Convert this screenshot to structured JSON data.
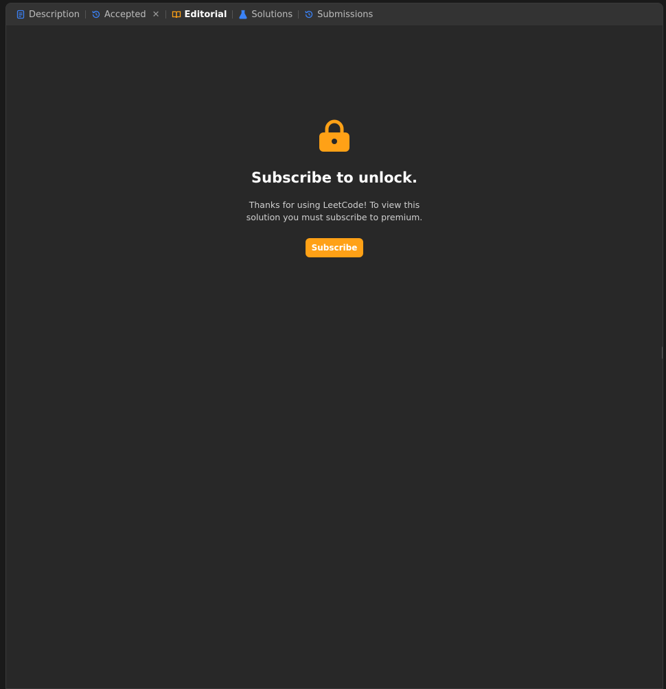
{
  "tabs": [
    {
      "label": "Description",
      "icon": "document-icon",
      "color": "#3b82f6"
    },
    {
      "label": "Accepted",
      "icon": "history-icon",
      "color": "#3b82f6",
      "closable": true
    },
    {
      "label": "Editorial",
      "icon": "book-icon",
      "color": "#ffa116",
      "active": true
    },
    {
      "label": "Solutions",
      "icon": "flask-icon",
      "color": "#3b82f6"
    },
    {
      "label": "Submissions",
      "icon": "history-icon",
      "color": "#3b82f6"
    }
  ],
  "lock": {
    "icon": "lock-icon",
    "title": "Subscribe to unlock.",
    "message": "Thanks for using LeetCode! To view this solution you must subscribe to premium.",
    "button_label": "Subscribe"
  },
  "colors": {
    "accent": "#ffa116",
    "tab_icon": "#3b82f6",
    "background": "#282828",
    "tabbar": "#333333"
  }
}
